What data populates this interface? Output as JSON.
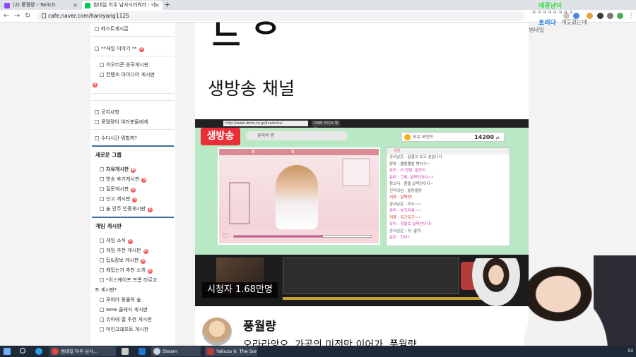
{
  "browser": {
    "tabs": [
      {
        "label": "(2) 풍월량 - Twitch",
        "color": "#9146ff"
      },
      {
        "label": "썸네일 어우 남사시러워라 : 네",
        "color": "#03c75a"
      }
    ],
    "url": "cafe.naver.com/hanryang1125"
  },
  "chat": {
    "user1": "애쿵냥이",
    "msg1": "ㅋㅋㅋㅋㅋㅋㅋㅋ",
    "user2": "호리다",
    "msg2": "개웃겼는데",
    "msg3": "썸네일"
  },
  "sidebar": {
    "top_items": [
      {
        "label": "베스트게시글",
        "new": false
      },
      {
        "label": "**게임 이야기 **",
        "new": true
      }
    ],
    "sub_items": [
      {
        "label": "이오티콘 응모게시판",
        "new": false
      },
      {
        "label": "컨텐츠 아이디어 게시판",
        "new": true
      }
    ],
    "notice_items": [
      {
        "label": "공지사항"
      },
      {
        "label": "풍월량이 여러분들에게"
      }
    ],
    "chat_item": {
      "label": "수다시간 뭐할까?"
    },
    "new_group_title": "새로운 그룹",
    "new_group_items": [
      {
        "label": "자유게시판",
        "new": true
      },
      {
        "label": "방송 후기게시판",
        "new": true
      },
      {
        "label": "질문게시판",
        "new": true
      },
      {
        "label": "신고 게시판",
        "new": true
      },
      {
        "label": "술 안주 인증게시판",
        "new": true
      }
    ],
    "game_group_title": "게임 게시판",
    "game_items": [
      {
        "label": "게임 소식",
        "new": true
      },
      {
        "label": "게임 추천 게시판",
        "new": true
      },
      {
        "label": "팁&정보 게시판",
        "new": true
      },
      {
        "label": "재밌는거 추천 소개",
        "new": true
      },
      {
        "label": "*이스케이프 프롬 타르코",
        "new": false
      },
      {
        "label": "프 게시판*",
        "new": false
      },
      {
        "label": "모여라 동물의 숲",
        "new": false
      },
      {
        "label": "wow 클래식 게시판",
        "new": false
      },
      {
        "label": "슈마에 맵 추천 게시판",
        "new": false
      },
      {
        "label": "마인크래프트 게시판",
        "new": false
      }
    ],
    "new_badge": "N"
  },
  "article": {
    "section_title": "생방송 채널",
    "screenshot": {
      "url_text": "http://www.dmm.co.jp/live/nchs/",
      "tab_text": "DMM 라이브 채팅",
      "live_badge": "생방송",
      "channel_select": "유미의 방",
      "points_label": "보유 포인트",
      "points_value": "14200",
      "points_unit": "pt",
      "player_numbers": [
        "8",
        "6"
      ],
      "chat_header": "게임",
      "chat_lines": [
        {
          "text": "공사남운 : 살결이 보고 싶습니다",
          "tone": "gray"
        },
        {
          "text": "창밖 : 졸렵졸렵 빳차구~",
          "tone": "gray"
        },
        {
          "text": "유미 : 아 정말, 말았어",
          "tone": "pink"
        },
        {
          "text": "유미 : 그럼, 살짝만이다~?",
          "tone": "pink"
        },
        {
          "text": "참스터 : 좀을 살짝만이지~",
          "tone": "gray"
        },
        {
          "text": "전직이넘 : 홀랑홀랑",
          "tone": "gray"
        },
        {
          "text": "키류 : 살짝만!",
          "tone": "red"
        },
        {
          "text": "공사남운 : 호오~~",
          "tone": "gray"
        },
        {
          "text": "유미 : 부끄러워~~",
          "tone": "pink"
        },
        {
          "text": "키류 : 두근두근~~",
          "tone": "red"
        },
        {
          "text": "유미 : 정말로 살짝만이다!",
          "tone": "pink"
        },
        {
          "text": "공사남운 : 꾸, 꿀꺽",
          "tone": "gray"
        },
        {
          "text": "유미 : 간다?",
          "tone": "pink"
        }
      ],
      "viewers": "시청자 1.68만명"
    },
    "author_name": "풍월량",
    "author_sub": "오라라앙오, 가공의 미전만 이어가, 풍월량"
  },
  "taskbar": {
    "apps": [
      {
        "label": "썸네일 어우 남사...",
        "color": "#e0443e"
      },
      {
        "label": "Steam",
        "color": "#1b2838"
      },
      {
        "label": "Yakuza 6: The Son...",
        "color": "#b63b3b"
      }
    ],
    "clock": "03"
  },
  "colors": {
    "live_red": "#ea2d37",
    "new_badge": "#f25a5a",
    "section_rule": "#3d6ca3"
  }
}
